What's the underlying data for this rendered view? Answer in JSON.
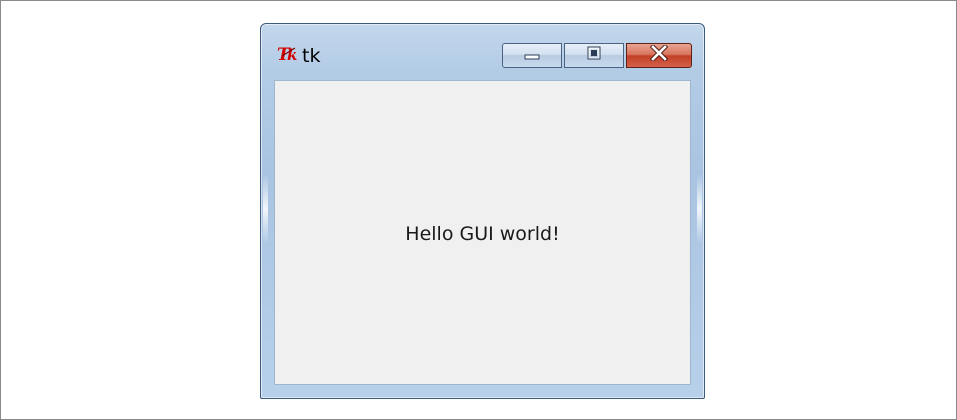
{
  "window": {
    "title": "tk",
    "icon": "tk-feather-icon",
    "buttons": {
      "minimize": "minimize-icon",
      "maximize": "maximize-icon",
      "close": "close-icon"
    }
  },
  "content": {
    "label": "Hello GUI world!"
  },
  "colors": {
    "client_background": "#f0f0f0",
    "frame": "#b3cce6",
    "close_button": "#c24026"
  }
}
